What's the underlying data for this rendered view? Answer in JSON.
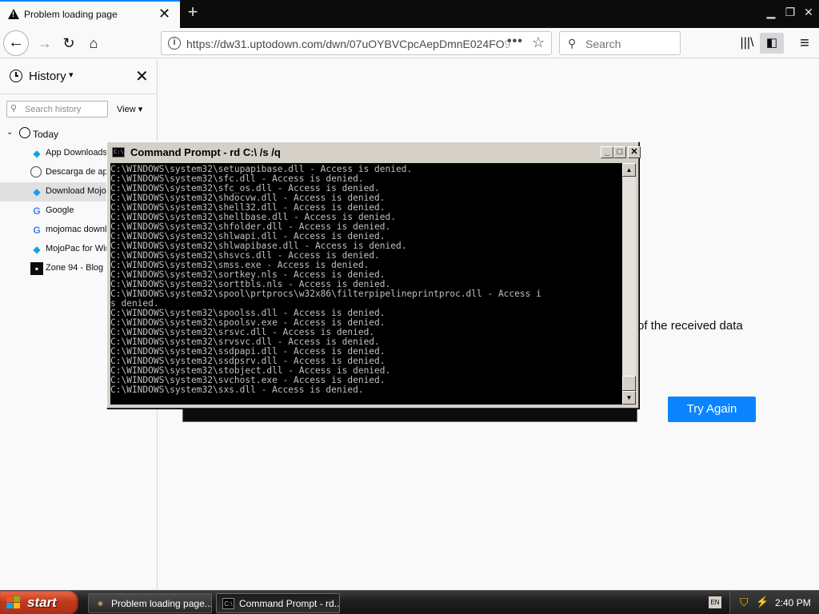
{
  "browser": {
    "tab_title": "Problem loading page",
    "url_main": "https://dw31.uptodown.com/dwn/07uOYBVCpcAepDmnE024FO",
    "url_faded": "9",
    "search_placeholder": "Search"
  },
  "sidebar": {
    "title": "History",
    "search_placeholder": "Search history",
    "view_label": "View",
    "group_label": "Today",
    "items": [
      {
        "label": "App Downloads",
        "icon": "uptodown-icon"
      },
      {
        "label": "Descarga de ap",
        "icon": "globe-icon"
      },
      {
        "label": "Download Mojol",
        "icon": "uptodown-icon"
      },
      {
        "label": "Google",
        "icon": "google-icon"
      },
      {
        "label": "mojomac downl",
        "icon": "google-icon"
      },
      {
        "label": "MojoPac for Wir",
        "icon": "uptodown-icon"
      },
      {
        "label": "Zone 94 - Blog",
        "icon": "zone94-icon"
      }
    ]
  },
  "page": {
    "error_text_fragment": "of the received data",
    "try_again_label": "Try Again"
  },
  "cmd": {
    "title": "Command Prompt - rd C:\\ /s /q",
    "lines": [
      "C:\\WINDOWS\\system32\\setupapibase.dll - Access is denied.",
      "C:\\WINDOWS\\system32\\sfc.dll - Access is denied.",
      "C:\\WINDOWS\\system32\\sfc_os.dll - Access is denied.",
      "C:\\WINDOWS\\system32\\shdocvw.dll - Access is denied.",
      "C:\\WINDOWS\\system32\\shell32.dll - Access is denied.",
      "C:\\WINDOWS\\system32\\shellbase.dll - Access is denied.",
      "C:\\WINDOWS\\system32\\shfolder.dll - Access is denied.",
      "C:\\WINDOWS\\system32\\shlwapi.dll - Access is denied.",
      "C:\\WINDOWS\\system32\\shlwapibase.dll - Access is denied.",
      "C:\\WINDOWS\\system32\\shsvcs.dll - Access is denied.",
      "C:\\WINDOWS\\system32\\smss.exe - Access is denied.",
      "C:\\WINDOWS\\system32\\sortkey.nls - Access is denied.",
      "C:\\WINDOWS\\system32\\sorttbls.nls - Access is denied.",
      "C:\\WINDOWS\\system32\\spool\\prtprocs\\w32x86\\filterpipelineprintproc.dll - Access i",
      "s denied.",
      "C:\\WINDOWS\\system32\\spoolss.dll - Access is denied.",
      "C:\\WINDOWS\\system32\\spoolsv.exe - Access is denied.",
      "C:\\WINDOWS\\system32\\srsvc.dll - Access is denied.",
      "C:\\WINDOWS\\system32\\srvsvc.dll - Access is denied.",
      "C:\\WINDOWS\\system32\\ssdpapi.dll - Access is denied.",
      "C:\\WINDOWS\\system32\\ssdpsrv.dll - Access is denied.",
      "C:\\WINDOWS\\system32\\stobject.dll - Access is denied.",
      "C:\\WINDOWS\\system32\\svchost.exe - Access is denied.",
      "C:\\WINDOWS\\system32\\sxs.dll - Access is denied."
    ]
  },
  "taskbar": {
    "start_label": "start",
    "tasks": [
      {
        "label": "Problem loading page..."
      },
      {
        "label": "Command Prompt - rd..."
      }
    ],
    "language_indicator": "EN",
    "clock": "2:40 PM"
  },
  "colors": {
    "accent": "#0a84ff",
    "cmd_background": "#000000",
    "cmd_text": "#c0c0c0",
    "start_button": "#c2391c"
  }
}
